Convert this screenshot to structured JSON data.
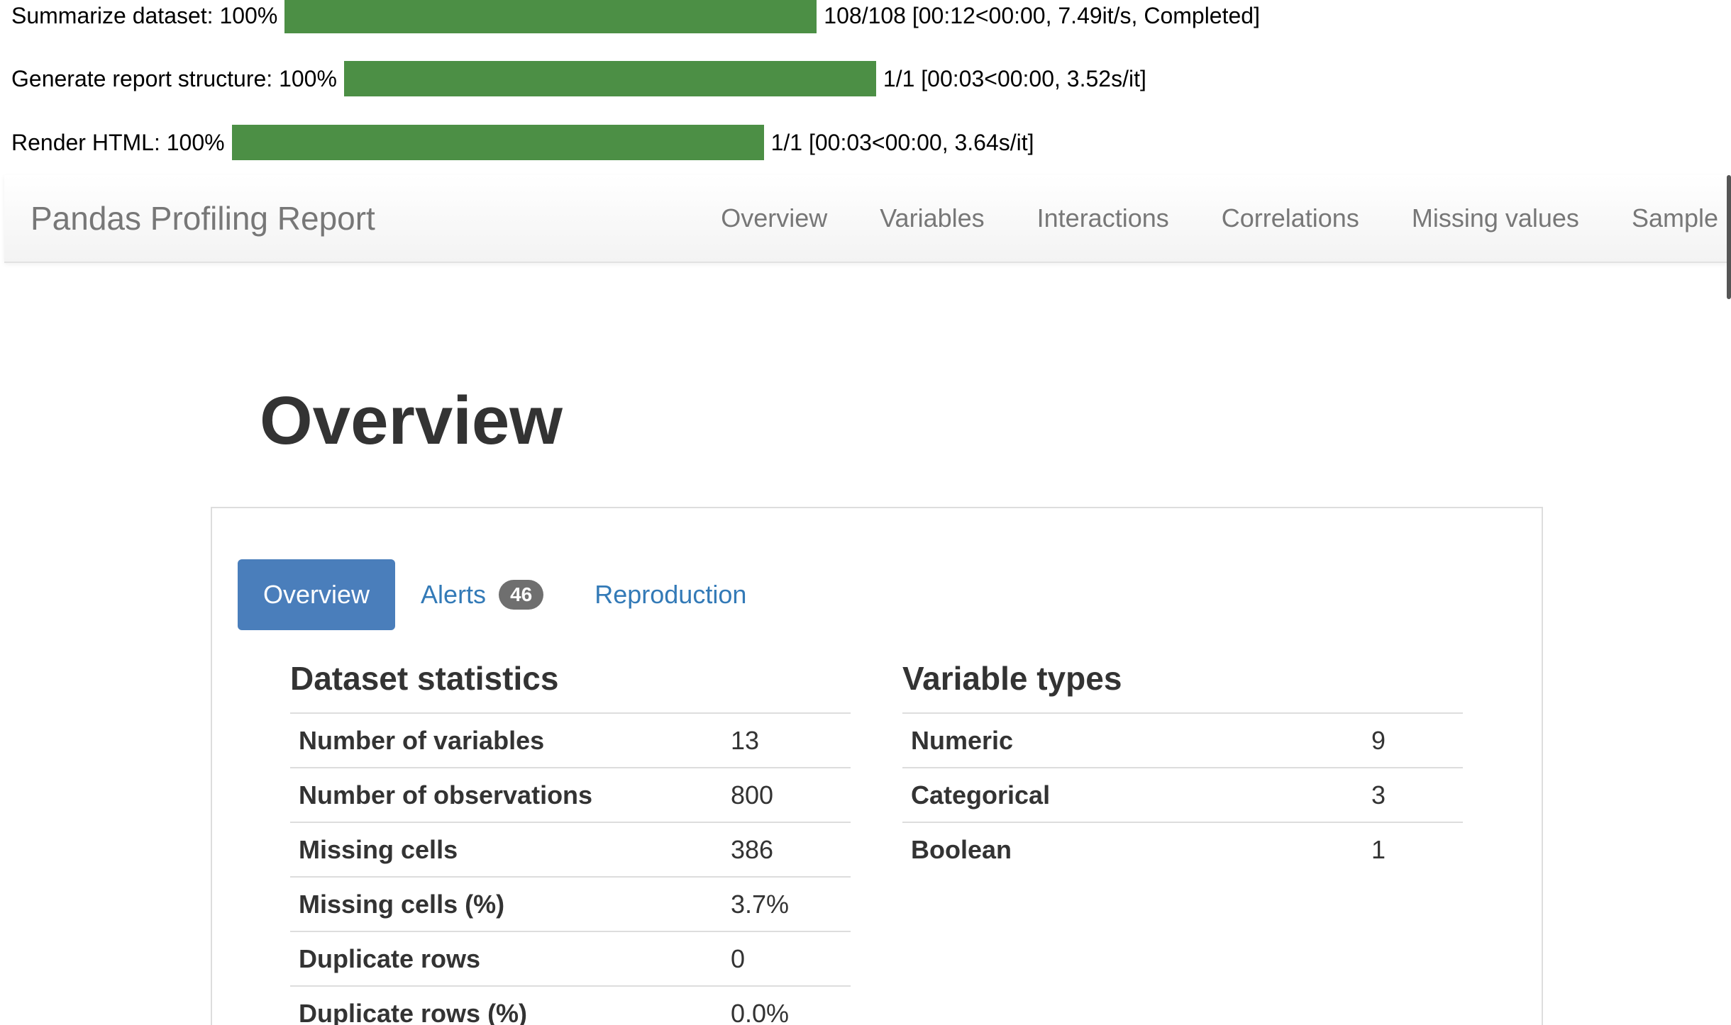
{
  "progress": [
    {
      "label": "Summarize dataset: 100%",
      "fraction": 1.0,
      "stats": "108/108 [00:12<00:00, 7.49it/s, Completed]"
    },
    {
      "label": "Generate report structure: 100%",
      "fraction": 1.0,
      "stats": "1/1 [00:03<00:00, 3.52s/it]"
    },
    {
      "label": "Render HTML: 100%",
      "fraction": 1.0,
      "stats": "1/1 [00:03<00:00, 3.64s/it]"
    }
  ],
  "colors": {
    "progress_fill": "#4c8f45",
    "active_tab": "#4a7ebb",
    "link": "#337ab7",
    "badge": "#6f6f6f"
  },
  "navbar": {
    "brand": "Pandas Profiling Report",
    "links": [
      "Overview",
      "Variables",
      "Interactions",
      "Correlations",
      "Missing values",
      "Sample"
    ]
  },
  "page_title": "Overview",
  "tabs": {
    "overview": "Overview",
    "alerts": "Alerts",
    "alerts_count": "46",
    "reproduction": "Reproduction"
  },
  "dataset_statistics": {
    "heading": "Dataset statistics",
    "rows": [
      {
        "label": "Number of variables",
        "value": "13"
      },
      {
        "label": "Number of observations",
        "value": "800"
      },
      {
        "label": "Missing cells",
        "value": "386"
      },
      {
        "label": "Missing cells (%)",
        "value": "3.7%"
      },
      {
        "label": "Duplicate rows",
        "value": "0"
      },
      {
        "label": "Duplicate rows (%)",
        "value": "0.0%"
      }
    ]
  },
  "variable_types": {
    "heading": "Variable types",
    "rows": [
      {
        "label": "Numeric",
        "value": "9"
      },
      {
        "label": "Categorical",
        "value": "3"
      },
      {
        "label": "Boolean",
        "value": "1"
      }
    ]
  }
}
